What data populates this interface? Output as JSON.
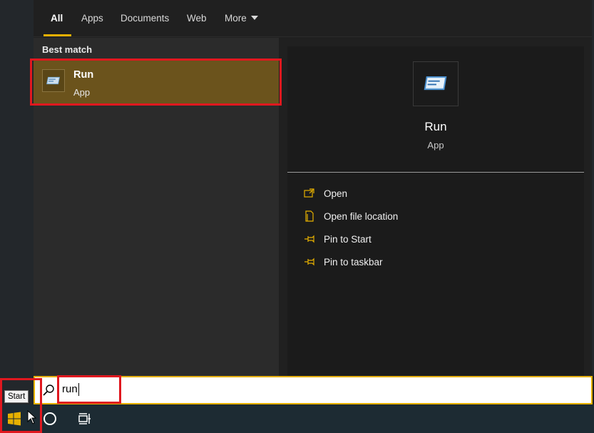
{
  "tabs": [
    {
      "label": "All",
      "active": true
    },
    {
      "label": "Apps"
    },
    {
      "label": "Documents"
    },
    {
      "label": "Web"
    },
    {
      "label": "More"
    }
  ],
  "left": {
    "best_match_label": "Best match",
    "result": {
      "title": "Run",
      "subtitle": "App",
      "icon": "run-app-icon"
    }
  },
  "preview": {
    "title": "Run",
    "subtitle": "App",
    "icon": "run-app-icon",
    "actions": [
      {
        "label": "Open",
        "icon": "open-icon"
      },
      {
        "label": "Open file location",
        "icon": "file-location-icon"
      },
      {
        "label": "Pin to Start",
        "icon": "pin-icon"
      },
      {
        "label": "Pin to taskbar",
        "icon": "pin-icon"
      }
    ]
  },
  "search": {
    "value": "run",
    "icon": "search-icon"
  },
  "taskbar": {
    "start_tooltip": "Start",
    "items": [
      "windows-start-icon",
      "cortana-circle-icon",
      "task-view-icon"
    ]
  },
  "colors": {
    "accent": "#e6b000",
    "selected_result_bg": "#6b531c",
    "highlight_box": "#e0181f",
    "taskbar_bg": "#1d2b33"
  }
}
